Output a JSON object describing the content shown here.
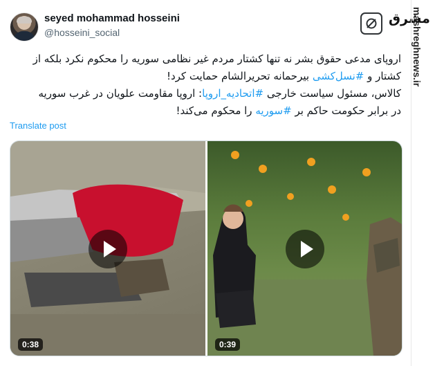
{
  "author": {
    "display_name": "seyed mohammad hosseini",
    "handle": "@hosseini_social",
    "avatar": "profile-photo"
  },
  "branding": {
    "logo_icon": "mashregh-logo-icon",
    "wordmark": "مشرق",
    "side_url": "mashreghnews.ir"
  },
  "tweet": {
    "line1": "اروپای مدعی حقوق بشر نه تنها کشتار مردم غیر نظامی سوریه را محکوم نکرد بلکه از",
    "line2_part1": "کشتار و ",
    "line2_hashtag": "#نسل‌کشی",
    "line2_part2": " بیرحمانه تحریرالشام حمایت کرد!",
    "line3_part1": "کالاس، مسئول سیاست خارجی ",
    "line3_hashtag": "#اتحادیه_اروپا",
    "line3_part2": ": اروپا مقاومت علویان در غرب سوریه",
    "line4_part1": "در برابر حکومت حاکم بر ",
    "line4_hashtag": "#سوریه",
    "line4_part2": " را محکوم می‌کند!"
  },
  "translate_label": "Translate post",
  "media": [
    {
      "duration": "0:38",
      "icon": "play-icon"
    },
    {
      "duration": "0:39",
      "icon": "play-icon"
    }
  ],
  "colors": {
    "link": "#1d9bf0",
    "text": "#0f1419",
    "muted": "#536471"
  }
}
